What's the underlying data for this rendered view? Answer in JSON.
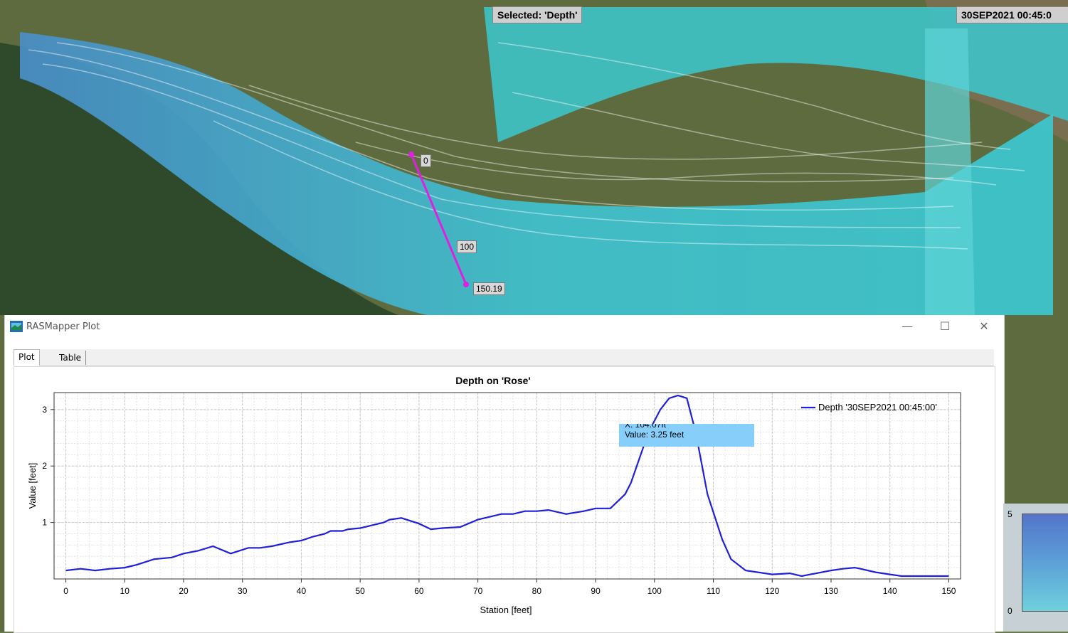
{
  "map": {
    "selected_label": "Selected: 'Depth'",
    "time_label": "30SEP2021 00:45:0",
    "stations": [
      "0",
      "100",
      "150.19"
    ]
  },
  "window": {
    "title": "RASMapper Plot",
    "minimize": "—",
    "maximize": "☐",
    "close": "✕",
    "tabs": [
      {
        "label": "Plot"
      },
      {
        "label": "Table"
      }
    ]
  },
  "tooltip": {
    "line1": "X: 104.07ft",
    "line2": "Value: 3.25 feet"
  },
  "legend_ramp": {
    "max": "5",
    "min": "0"
  },
  "colors": {
    "series": "#1f1fdc",
    "water": "#3cc8d0",
    "profile_line": "#e020e0"
  },
  "chart_data": {
    "type": "line",
    "title": "Depth on 'Rose'",
    "xlabel": "Station [feet]",
    "ylabel": "Value [feet]",
    "xlim": [
      -2,
      152
    ],
    "ylim": [
      0,
      3.3
    ],
    "xticks": [
      0,
      10,
      20,
      30,
      40,
      50,
      60,
      70,
      80,
      90,
      100,
      110,
      120,
      130,
      140,
      150
    ],
    "yticks": [
      1,
      2,
      3
    ],
    "grid": true,
    "legend_position": "top-right",
    "series": [
      {
        "name": "Depth '30SEP2021 00:45:00'",
        "x": [
          0,
          2.5,
          5,
          7.5,
          10,
          12,
          15,
          18,
          20,
          22.5,
          25,
          28,
          31,
          33,
          35,
          38,
          40,
          42,
          44,
          45,
          47,
          48,
          50,
          52,
          54,
          55,
          57,
          60,
          62,
          64,
          67,
          70,
          72,
          74,
          76,
          78,
          80,
          82,
          85,
          88,
          90,
          92.5,
          95,
          96,
          99,
          101,
          102.5,
          104,
          105.5,
          107,
          109,
          111.5,
          113,
          115.5,
          120,
          123,
          125,
          130,
          132,
          134,
          135,
          137.5,
          140,
          142,
          145,
          147.5,
          150
        ],
        "y": [
          0.15,
          0.18,
          0.15,
          0.18,
          0.2,
          0.25,
          0.35,
          0.38,
          0.45,
          0.5,
          0.58,
          0.45,
          0.55,
          0.55,
          0.58,
          0.65,
          0.68,
          0.75,
          0.8,
          0.85,
          0.85,
          0.88,
          0.9,
          0.95,
          1.0,
          1.05,
          1.08,
          0.98,
          0.88,
          0.9,
          0.92,
          1.05,
          1.1,
          1.15,
          1.15,
          1.2,
          1.2,
          1.22,
          1.15,
          1.2,
          1.25,
          1.25,
          1.5,
          1.7,
          2.6,
          3.0,
          3.2,
          3.25,
          3.2,
          2.6,
          1.5,
          0.7,
          0.35,
          0.15,
          0.08,
          0.1,
          0.05,
          0.15,
          0.18,
          0.2,
          0.18,
          0.12,
          0.08,
          0.05,
          0.05,
          0.05,
          0.05
        ]
      }
    ]
  }
}
